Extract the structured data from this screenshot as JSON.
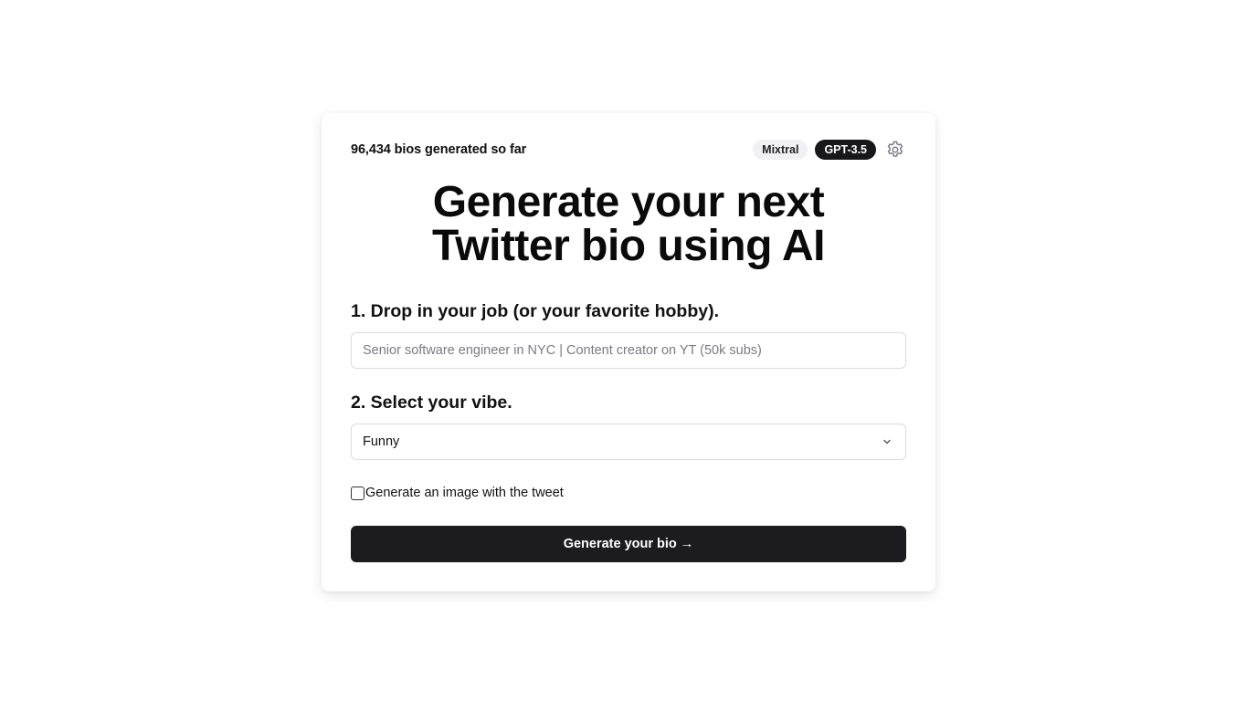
{
  "header": {
    "counter_text": "96,434 bios generated so far",
    "models": [
      {
        "label": "Mixtral",
        "active": false
      },
      {
        "label": "GPT-3.5",
        "active": true
      }
    ],
    "settings_icon": "gear-icon"
  },
  "hero": {
    "title_line_1": "Generate your next",
    "title_line_2": "Twitter bio using AI"
  },
  "form": {
    "step1_label": "1. Drop in your job (or your favorite hobby).",
    "job_input": {
      "value": "",
      "placeholder": "Senior software engineer in NYC | Content creator on YT (50k subs)"
    },
    "step2_label": "2. Select your vibe.",
    "vibe_select": {
      "selected": "Funny",
      "icon": "chevron-down-icon"
    },
    "image_checkbox": {
      "checked": false,
      "label": "Generate an image with the tweet"
    },
    "submit_label": "Generate your bio →"
  },
  "colors": {
    "primary_button": "#1c1c1f",
    "active_pill": "#18181b",
    "inactive_pill": "#f1f1f3",
    "border": "#dcdce0"
  }
}
